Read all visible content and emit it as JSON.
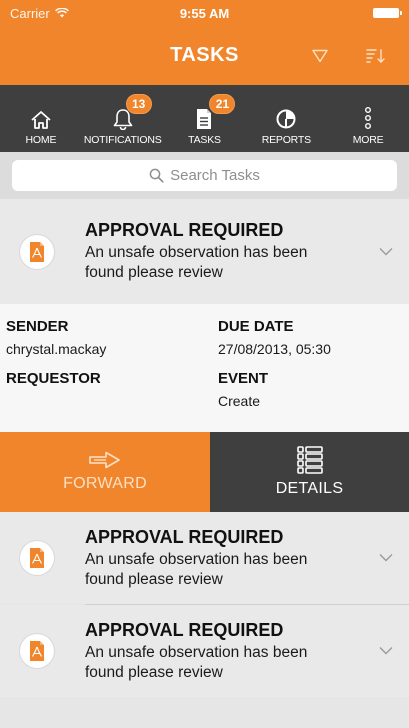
{
  "status": {
    "carrier": "Carrier",
    "time": "9:55 AM"
  },
  "nav": {
    "title": "TASKS"
  },
  "tabs": [
    {
      "label": "HOME",
      "icon": "home-icon"
    },
    {
      "label": "NOTIFICATIONS",
      "icon": "bell-icon",
      "badge": "13"
    },
    {
      "label": "TASKS",
      "icon": "document-icon",
      "badge": "21"
    },
    {
      "label": "REPORTS",
      "icon": "pie-chart-icon"
    },
    {
      "label": "MORE",
      "icon": "more-icon"
    }
  ],
  "search": {
    "placeholder": "Search Tasks"
  },
  "tasks": [
    {
      "title": "APPROVAL REQUIRED",
      "line1": "An unsafe observation has been",
      "line2": "found please review"
    },
    {
      "title": "APPROVAL REQUIRED",
      "line1": "An unsafe observation has been",
      "line2": "found please review"
    },
    {
      "title": "APPROVAL REQUIRED",
      "line1": "An unsafe observation has been",
      "line2": "found please review"
    }
  ],
  "detail": {
    "sender_label": "SENDER",
    "sender_value": "chrystal.mackay",
    "due_label": "DUE DATE",
    "due_value": "27/08/2013, 05:30",
    "requestor_label": "REQUESTOR",
    "event_label": "EVENT",
    "event_value": "Create"
  },
  "actions": {
    "forward": "FORWARD",
    "details": "DETAILS"
  },
  "colors": {
    "accent": "#f0852b",
    "dark": "#3f3f3f",
    "card": "#e9e9e9"
  }
}
